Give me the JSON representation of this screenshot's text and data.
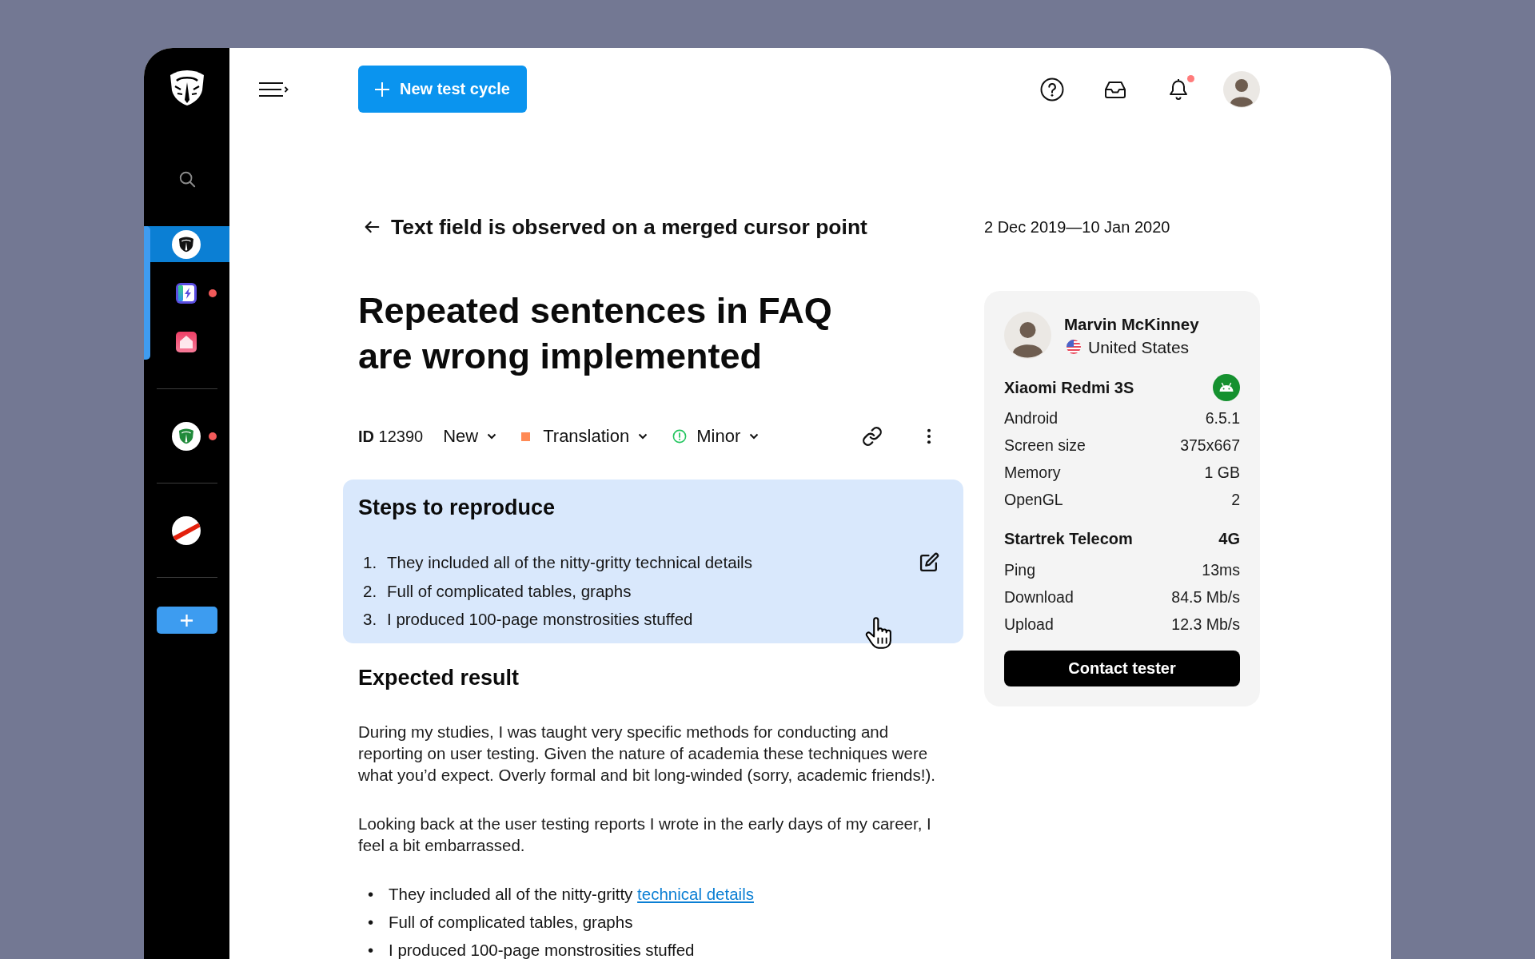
{
  "sidebar": {
    "groups": [
      {
        "active": true,
        "items": [
          {
            "kind": "shield",
            "selected": true,
            "unread": false
          },
          {
            "kind": "bolt",
            "selected": false,
            "unread": true
          },
          {
            "kind": "house",
            "selected": false,
            "unread": false
          }
        ]
      },
      {
        "active": false,
        "items": [
          {
            "kind": "green-shield",
            "selected": false,
            "unread": true
          }
        ]
      },
      {
        "active": false,
        "items": [
          {
            "kind": "stripe",
            "selected": false,
            "unread": false
          }
        ]
      }
    ]
  },
  "topbar": {
    "new_button": {
      "label": "New test cycle"
    },
    "notifications": {
      "unread": true
    }
  },
  "header": {
    "back_title": "Text field is observed on a merged cursor point",
    "date_range": "2 Dec 2019—10 Jan 2020"
  },
  "issue": {
    "title": "Repeated sentences in FAQ are wrong implemented",
    "id": "**ID** 12390",
    "fields": [
      {
        "kind": "status",
        "label": "New"
      },
      {
        "kind": "category",
        "label": "Translation",
        "color": "#ff8a55"
      },
      {
        "kind": "severity",
        "label": "Minor",
        "color": "#22c55e"
      }
    ],
    "steps": {
      "title": "Steps to reproduce",
      "items": [
        {
          "number": "1.",
          "text": "They included all of the nitty-gritty technical details"
        },
        {
          "number": "2.",
          "text": "Full of complicated tables, graphs"
        },
        {
          "number": "3.",
          "text": "I produced 100-page monstrosities stuffed"
        }
      ]
    },
    "expected": {
      "title": "Expected result",
      "paragraphs": [
        "During my studies, I was taught very specific methods for conducting and reporting on user testing. Given the nature of academia these techniques were what you’d expect. Overly formal and bit long-winded (sorry, academic friends!).",
        "Looking back at the user testing reports I wrote in the early days of my career, I feel a bit embarrassed."
      ],
      "bullets": [
        {
          "marker": "•",
          "text": "They included all of the nitty-gritty ",
          "link": "technical details"
        },
        {
          "marker": "•",
          "text": "Full of complicated tables, graphs"
        },
        {
          "marker": "•",
          "text": "I produced 100-page monstrosities stuffed"
        }
      ]
    }
  },
  "tester": {
    "name": "Marvin McKinney",
    "country": "United States",
    "device": {
      "name": "Xiaomi Redmi 3S",
      "specs": [
        {
          "label": "Android",
          "value": "6.5.1"
        },
        {
          "label": "Screen size",
          "value": "375x667"
        },
        {
          "label": "Memory",
          "value": "1 GB"
        },
        {
          "label": "OpenGL",
          "value": "2"
        }
      ]
    },
    "network": {
      "name": "Startrek Telecom",
      "type": "4G",
      "stats": [
        {
          "label": "Ping",
          "value": "13ms"
        },
        {
          "label": "Download",
          "value": "84.5 Mb/s"
        },
        {
          "label": "Upload",
          "value": "12.3 Mb/s"
        }
      ]
    },
    "contact_button": "Contact tester"
  }
}
